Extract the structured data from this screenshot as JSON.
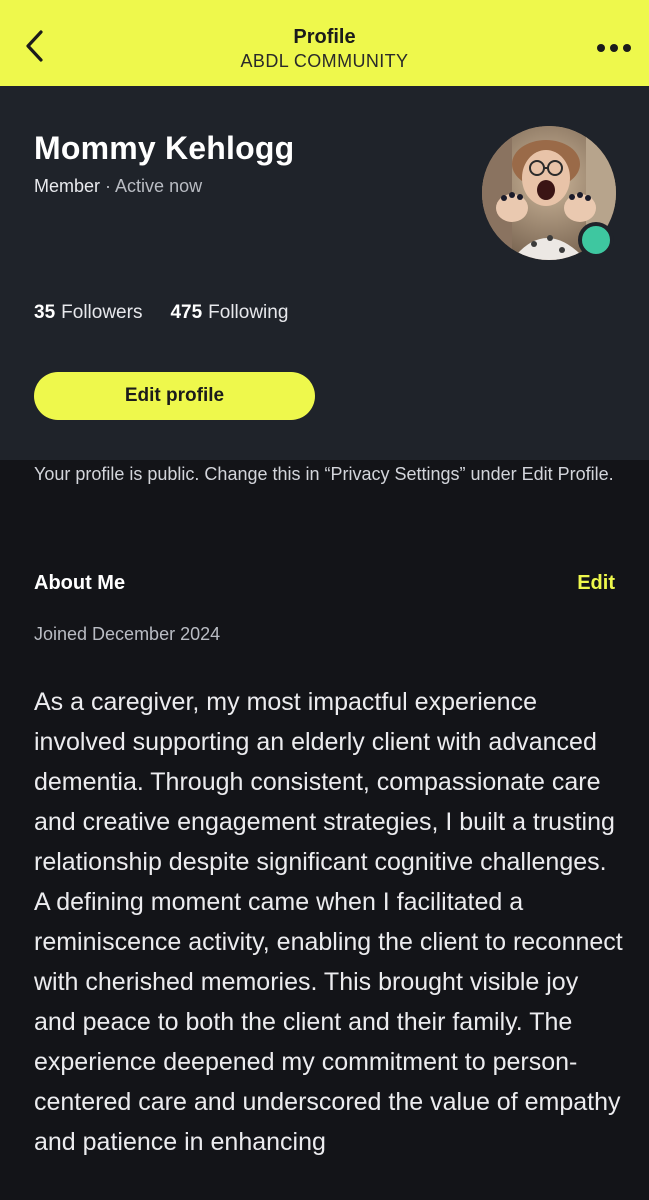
{
  "topbar": {
    "title": "Profile",
    "subtitle": "ABDL COMMUNITY",
    "icons": {
      "back": "chevron-left-icon",
      "more": "more-horizontal-icon"
    }
  },
  "profile": {
    "name": "Mommy Kehlogg",
    "role": "Member",
    "separator": "·",
    "status": "Active now",
    "followers_count": "35",
    "followers_label": "Followers",
    "following_count": "475",
    "following_label": "Following",
    "edit_button_label": "Edit profile",
    "online": true
  },
  "privacy_note": "Your profile is public. Change this in “Privacy Settings” under Edit Profile.",
  "about": {
    "heading": "About Me",
    "edit_label": "Edit",
    "joined": "Joined December 2024",
    "bio": "As a caregiver, my most impactful experience involved supporting an elderly client with advanced dementia. Through consistent, compassionate care and creative engagement strategies, I built a trusting relationship despite significant cognitive challenges. A defining moment came when I facilitated a reminiscence activity, enabling the client to reconnect with cherished memories. This brought visible joy and peace to both the client and their family. The experience deepened my commitment to person-centered care and underscored the value of empathy and patience in enhancing"
  },
  "colors": {
    "accent": "#eef84c",
    "background": "#131418",
    "card": "#1f232a",
    "online": "#3ec7a0"
  }
}
